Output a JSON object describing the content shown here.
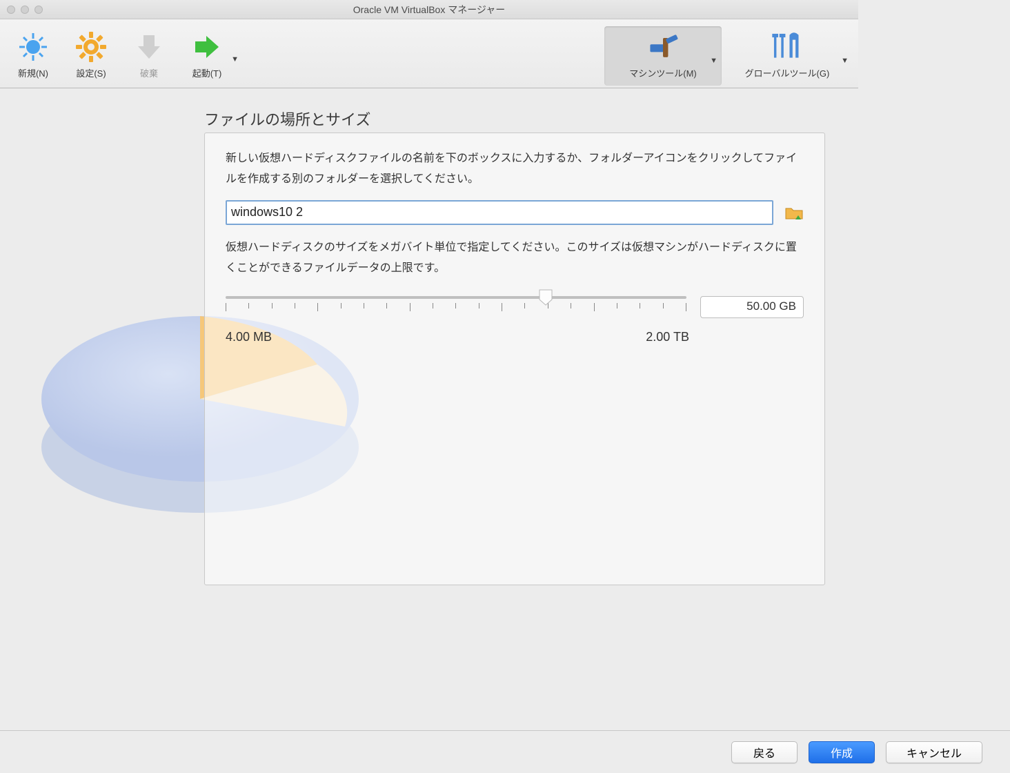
{
  "window": {
    "title": "Oracle VM VirtualBox マネージャー"
  },
  "toolbar": {
    "new_label": "新規(N)",
    "settings_label": "設定(S)",
    "discard_label": "破棄",
    "start_label": "起動(T)",
    "machine_tools_label": "マシンツール(M)",
    "global_tools_label": "グローバルツール(G)"
  },
  "sheet": {
    "heading": "ファイルの場所とサイズ",
    "desc1": "新しい仮想ハードディスクファイルの名前を下のボックスに入力するか、フォルダーアイコンをクリックしてファイルを作成する別のフォルダーを選択してください。",
    "filename_value": "windows10 2",
    "desc2": "仮想ハードディスクのサイズをメガバイト単位で指定してください。このサイズは仮想マシンがハードディスクに置くことができるファイルデータの上限です。",
    "size_min_label": "4.00 MB",
    "size_max_label": "2.00 TB",
    "size_value": "50.00 GB"
  },
  "footer": {
    "back_label": "戻る",
    "create_label": "作成",
    "cancel_label": "キャンセル"
  }
}
